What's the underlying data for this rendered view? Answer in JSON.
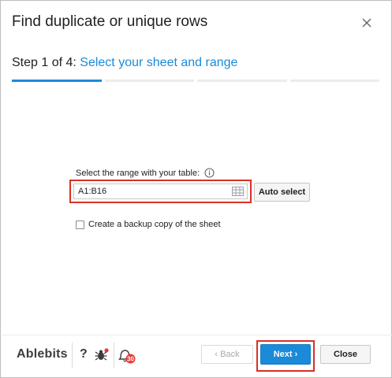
{
  "dialog": {
    "title": "Find duplicate or unique rows",
    "step_prefix": "Step 1 of 4: ",
    "step_name": "Select your sheet and range",
    "progress": {
      "current_step": 1,
      "total_steps": 4
    }
  },
  "form": {
    "range_label": "Select the range with your table:",
    "range_value": "A1:B16",
    "auto_select_label": "Auto select",
    "backup_label": "Create a backup copy of the sheet",
    "backup_checked": false
  },
  "footer": {
    "brand": "Ablebits",
    "help_label": "?",
    "notification_count": "30",
    "back_label": "‹ Back",
    "next_label": "Next ›",
    "close_label": "Close"
  },
  "colors": {
    "accent": "#1a8ad9",
    "highlight_border": "#d93025"
  }
}
